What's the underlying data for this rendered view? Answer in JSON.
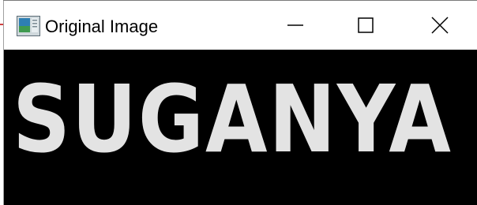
{
  "window": {
    "title": "Original Image",
    "icon": "image-window-icon",
    "controls": {
      "minimize_icon": "minimize-icon",
      "maximize_icon": "maximize-icon",
      "close_icon": "close-icon"
    }
  },
  "image": {
    "background_color": "#000000",
    "text": "SUGANYA",
    "text_color": "#e3e3e3"
  }
}
